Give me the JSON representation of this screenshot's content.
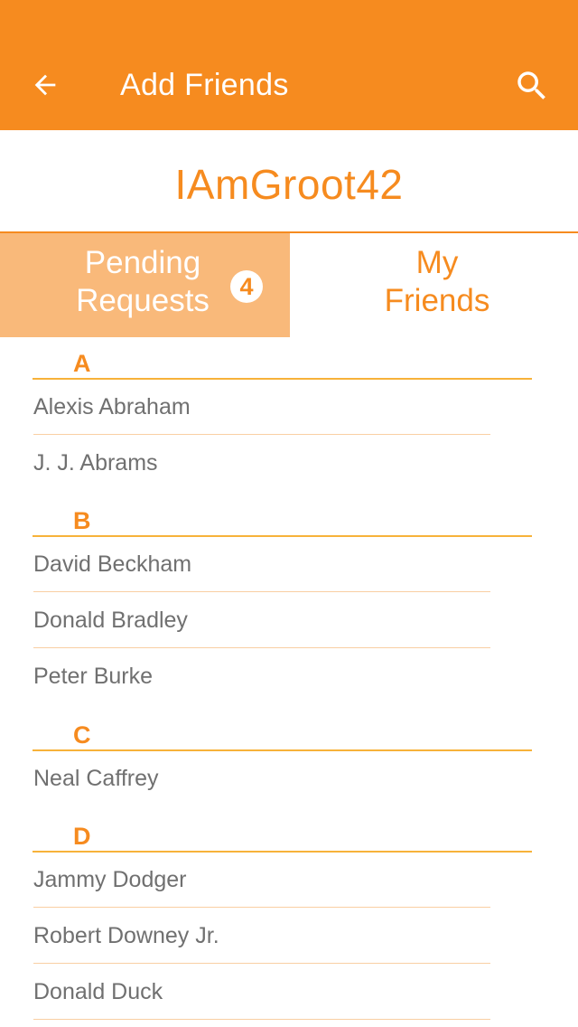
{
  "appbar": {
    "title": "Add Friends",
    "back_icon": "arrow-left-icon",
    "search_icon": "search-icon",
    "background": "#F68B1F"
  },
  "profile": {
    "username": "IAmGroot42"
  },
  "tabs": [
    {
      "label": "Pending\nRequests",
      "badge": "4",
      "active": true
    },
    {
      "label": "My\nFriends",
      "active": false
    }
  ],
  "sections": [
    {
      "letter": "A",
      "contacts": [
        "Alexis Abraham",
        "J. J. Abrams"
      ]
    },
    {
      "letter": "B",
      "contacts": [
        "David Beckham",
        "Donald Bradley",
        "Peter Burke"
      ]
    },
    {
      "letter": "C",
      "contacts": [
        "Neal Caffrey"
      ]
    },
    {
      "letter": "D",
      "contacts": [
        "Jammy Dodger",
        "Robert Downey Jr.",
        "Donald Duck"
      ]
    }
  ],
  "colors": {
    "accent": "#F68B1F",
    "tab_active_bg": "#F9B97A",
    "divider": "#F7B23A",
    "row_separator": "#F9CFA3",
    "name_text": "#707070"
  }
}
